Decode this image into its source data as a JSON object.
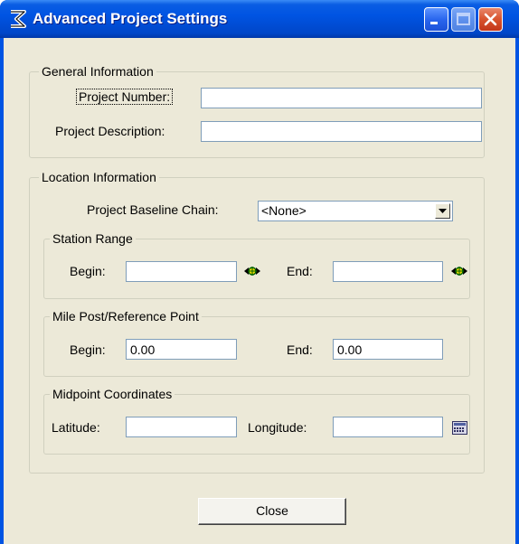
{
  "window": {
    "title": "Advanced Project Settings"
  },
  "general": {
    "legend": "General Information",
    "project_number_label": "Project Number:",
    "project_number_value": "",
    "project_description_label": "Project Description:",
    "project_description_value": ""
  },
  "location": {
    "legend": "Location Information",
    "baseline_chain_label": "Project Baseline Chain:",
    "baseline_chain_value": "<None>",
    "station_range": {
      "legend": "Station Range",
      "begin_label": "Begin:",
      "begin_value": "",
      "end_label": "End:",
      "end_value": ""
    },
    "mile_post": {
      "legend": "Mile Post/Reference Point",
      "begin_label": "Begin:",
      "begin_value": "0.00",
      "end_label": "End:",
      "end_value": "0.00"
    },
    "midpoint": {
      "legend": "Midpoint Coordinates",
      "latitude_label": "Latitude:",
      "latitude_value": "",
      "longitude_label": "Longitude:",
      "longitude_value": ""
    }
  },
  "buttons": {
    "close_label": "Close"
  }
}
